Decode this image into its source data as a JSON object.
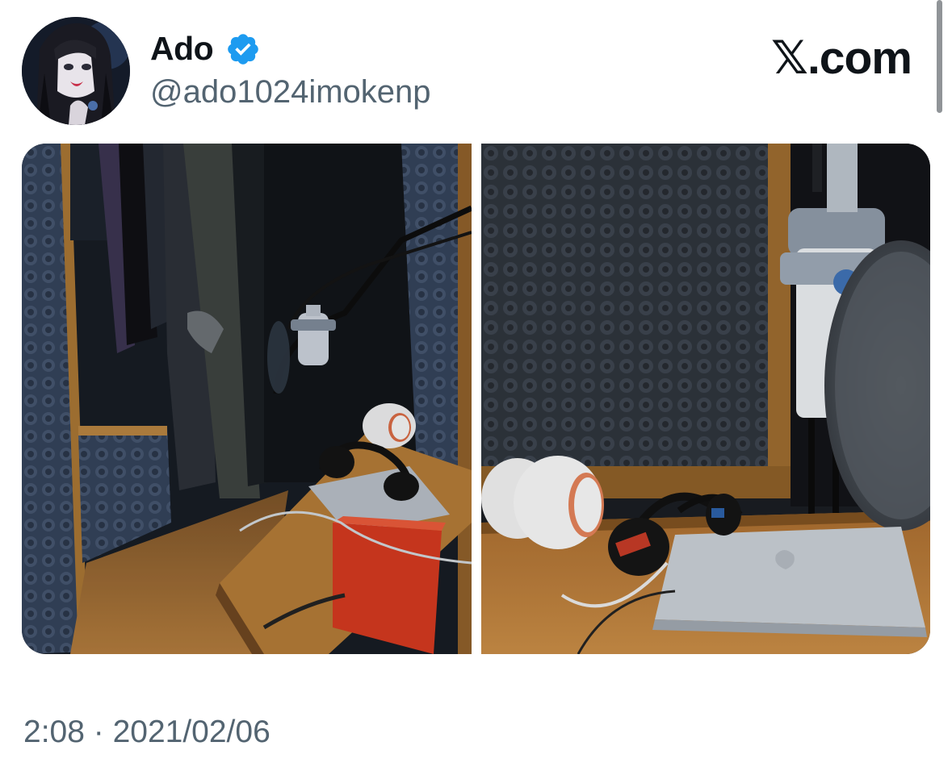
{
  "author": {
    "display_name": "Ado",
    "handle": "@ado1024imokenp",
    "verified": true,
    "avatar_icon": "profile-avatar"
  },
  "brand": {
    "text": "𝕏.com",
    "icon": "x-logo"
  },
  "media": {
    "count": 2,
    "photos": [
      {
        "icon": "recording-booth-photo"
      },
      {
        "icon": "microphone-headphones-photo"
      }
    ]
  },
  "timestamp": "2:08 · 2021/02/06",
  "colors": {
    "verified_badge": "#1d9bf0",
    "text_primary": "#0f1419",
    "text_secondary": "#536471",
    "background": "#ffffff"
  }
}
